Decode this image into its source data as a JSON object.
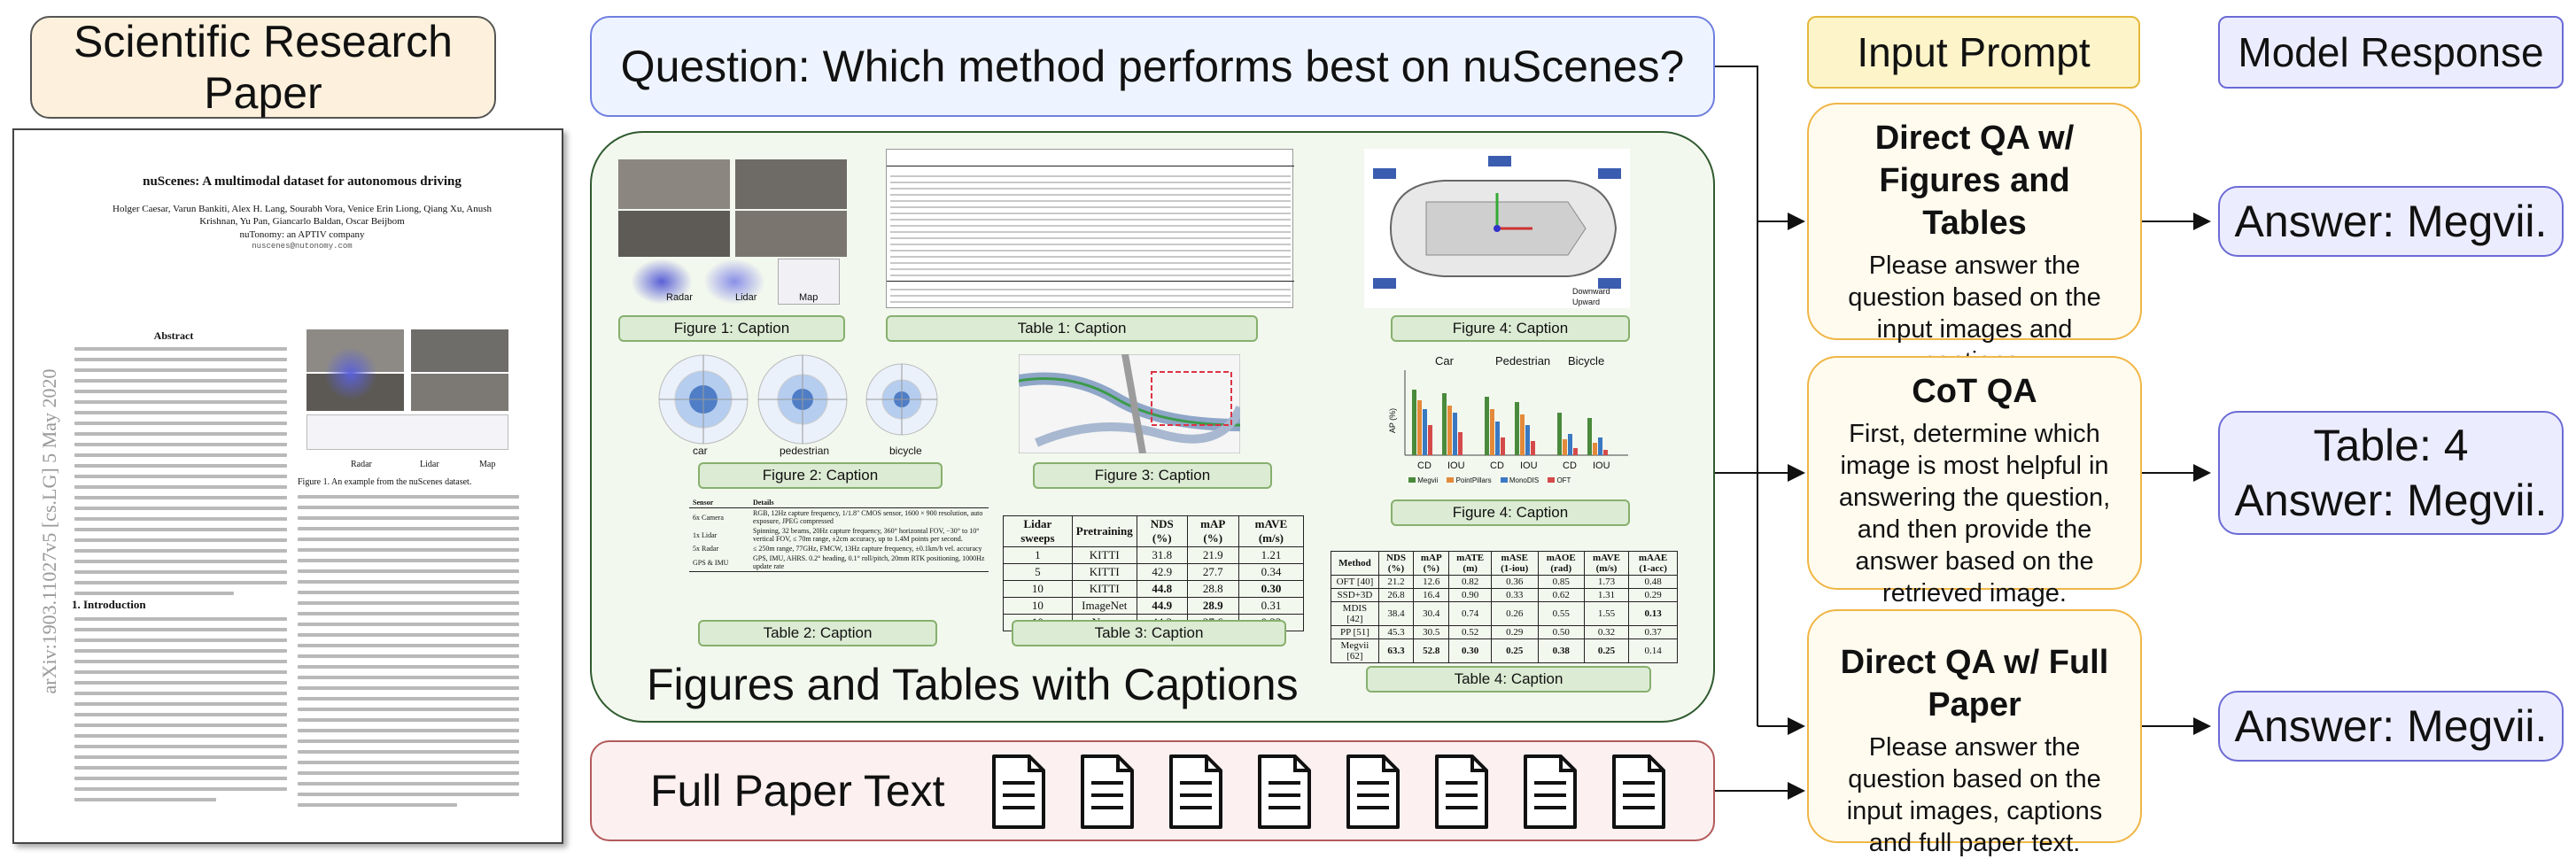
{
  "left": {
    "title": "Scientific Research Paper",
    "paper": {
      "title": "nuScenes: A multimodal dataset for autonomous driving",
      "authors": "Holger Caesar, Varun Bankiti, Alex H. Lang, Sourabh Vora, Venice Erin Liong, Qiang Xu, Anush Krishnan, Yu Pan, Giancarlo Baldan, Oscar Beijbom",
      "affiliation": "nuTonomy: an APTIV company",
      "email": "nuscenes@nutonomy.com",
      "abstract_heading": "Abstract",
      "intro_heading": "1. Introduction",
      "arxiv": "arXiv:1903.11027v5  [cs.LG]  5 May 2020",
      "fig_caption": "Figure 1. An example from the nuScenes dataset.",
      "fig_labels": [
        "Radar",
        "Lidar",
        "Map"
      ]
    }
  },
  "question": "Question: Which method performs best on nuScenes?",
  "figures_panel": {
    "title": "Figures and Tables with Captions",
    "captions": {
      "fig1": "Figure 1: Caption",
      "tab1": "Table 1: Caption",
      "fig4a": "Figure 4: Caption",
      "fig2": "Figure 2: Caption",
      "fig3": "Figure 3: Caption",
      "fig4b": "Figure 4: Caption",
      "tab2": "Table 2: Caption",
      "tab3": "Table 3: Caption",
      "tab4": "Table 4: Caption"
    },
    "fig1_labels": [
      "Radar",
      "Lidar",
      "Map"
    ],
    "polar_labels": [
      "car",
      "pedestrian",
      "bicycle"
    ],
    "bar_chart": {
      "groups": [
        "Car",
        "Pedestrian",
        "Bicycle"
      ],
      "xlabels": [
        "CD",
        "IOU",
        "CD",
        "IOU",
        "CD",
        "IOU"
      ],
      "ylabel": "AP (%)",
      "legend": [
        "Megvii",
        "PointPillars",
        "MonoDIS",
        "OFT"
      ],
      "colors": [
        "#4a8a3c",
        "#e38a3a",
        "#3a78c2",
        "#d44a4a"
      ]
    },
    "table3": {
      "headers": [
        "Lidar sweeps",
        "Pretraining",
        "NDS (%)",
        "mAP (%)",
        "mAVE (m/s)"
      ],
      "rows": [
        [
          "1",
          "KITTI",
          "31.8",
          "21.9",
          "1.21"
        ],
        [
          "5",
          "KITTI",
          "42.9",
          "27.7",
          "0.34"
        ],
        [
          "10",
          "KITTI",
          "44.8",
          "28.8",
          "0.30"
        ],
        [
          "10",
          "ImageNet",
          "44.9",
          "28.9",
          "0.31"
        ],
        [
          "10",
          "None",
          "44.2",
          "27.6",
          "0.33"
        ]
      ]
    },
    "table4": {
      "headers": [
        "Method",
        "NDS (%)",
        "mAP (%)",
        "mATE (m)",
        "mASE (1-iou)",
        "mAOE (rad)",
        "mAVE (m/s)",
        "mAAE (1-acc)"
      ],
      "rows": [
        [
          "OFT [40]",
          "21.2",
          "12.6",
          "0.82",
          "0.36",
          "0.85",
          "1.73",
          "0.48"
        ],
        [
          "SSD+3D",
          "26.8",
          "16.4",
          "0.90",
          "0.33",
          "0.62",
          "1.31",
          "0.29"
        ],
        [
          "MDIS [42]",
          "38.4",
          "30.4",
          "0.74",
          "0.26",
          "0.55",
          "1.55",
          "0.13"
        ],
        [
          "PP [51]",
          "45.3",
          "30.5",
          "0.52",
          "0.29",
          "0.50",
          "0.32",
          "0.37"
        ],
        [
          "Megvii [62]",
          "63.3",
          "52.8",
          "0.30",
          "0.25",
          "0.38",
          "0.25",
          "0.14"
        ]
      ]
    },
    "table2": {
      "headers": [
        "Sensor",
        "Details"
      ],
      "rows": [
        [
          "6x Camera",
          "RGB, 12Hz capture frequency, 1/1.8\" CMOS sensor, 1600 × 900 resolution, auto exposure, JPEG compressed"
        ],
        [
          "1x Lidar",
          "Spinning, 32 beams, 20Hz capture frequency, 360° horizontal FOV, −30° to 10° vertical FOV, ≤ 70m range, ±2cm accuracy, up to 1.4M points per second."
        ],
        [
          "5x Radar",
          "≤ 250m range, 77GHz, FMCW, 13Hz capture frequency, ±0.1km/h vel. accuracy"
        ],
        [
          "GPS & IMU",
          "GPS, IMU, AHRS. 0.2° heading, 0.1° roll/pitch, 20mm RTK positioning, 1000Hz update rate"
        ]
      ]
    },
    "fig4_legend": [
      "Downward",
      "Upward"
    ]
  },
  "full_text": {
    "title": "Full Paper Text",
    "doc_count": 8
  },
  "columns": {
    "input_title": "Input Prompt",
    "response_title": "Model Response"
  },
  "methods": [
    {
      "title": "Direct QA w/ Figures and Tables",
      "desc": "Please answer the question based on the input images and captions."
    },
    {
      "title": "CoT QA",
      "desc": "First, determine which image is most helpful in answering the question, and then provide the answer based on the retrieved image."
    },
    {
      "title": "Direct QA w/ Full Paper",
      "desc": "Please answer the question based on the input images, captions and full paper text."
    }
  ],
  "answers": [
    {
      "line1": "Answer: Megvii."
    },
    {
      "line1": "Table: 4",
      "line2": "Answer: Megvii."
    },
    {
      "line1": "Answer: Megvii."
    }
  ]
}
